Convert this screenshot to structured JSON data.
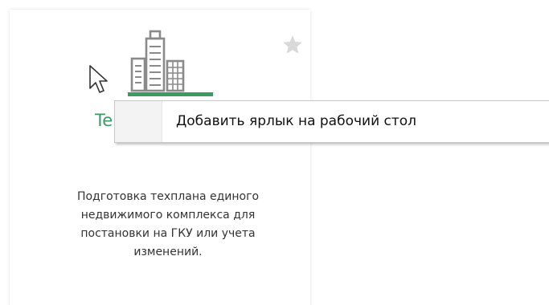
{
  "card": {
    "title": "Te",
    "description": "Подготовка техплана единого\nнедвижимого комплекса для\nпостановки на ГКУ или учета\nизменений."
  },
  "icons": {
    "favorite": "star-icon",
    "service": "buildings-icon",
    "pointer": "mouse-cursor-icon"
  },
  "context_menu": {
    "items": [
      {
        "label": "Добавить ярлык на рабочий стол"
      }
    ]
  },
  "colors": {
    "accent": "#3c9a63",
    "icon_gray": "#8a8a8a",
    "star_gray": "#d9d9d9"
  }
}
